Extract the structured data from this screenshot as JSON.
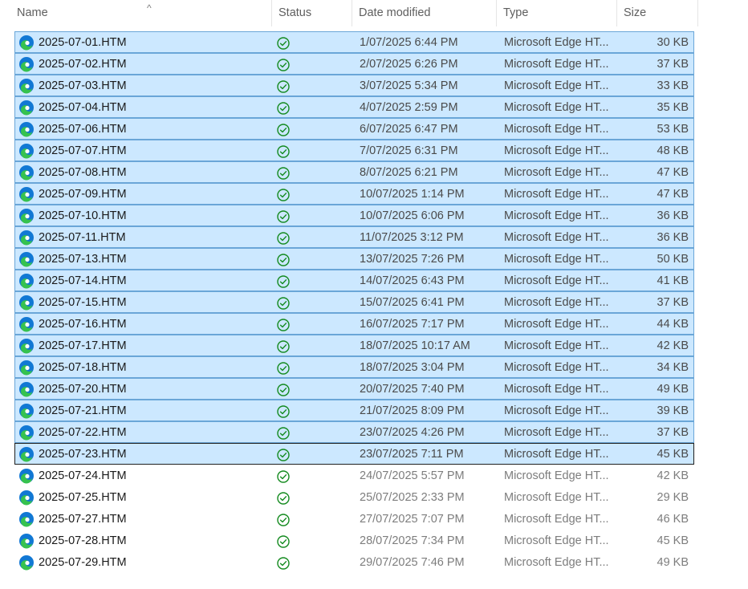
{
  "columns": {
    "name": "Name",
    "status": "Status",
    "date": "Date modified",
    "type": "Type",
    "size": "Size"
  },
  "sort_indicator": "^",
  "icons": {
    "file": "edge-file-icon",
    "status": "synced-check-icon"
  },
  "colors": {
    "selection_bg": "#cce8ff",
    "selection_border": "#6aa6d8",
    "status_green": "#138a1e",
    "edge_blue": "#1178d4",
    "edge_green": "#36c24f"
  },
  "files": [
    {
      "name": "2025-07-01.HTM",
      "date": "1/07/2025 6:44 PM",
      "type": "Microsoft Edge HT...",
      "size": "30 KB",
      "selected": true
    },
    {
      "name": "2025-07-02.HTM",
      "date": "2/07/2025 6:26 PM",
      "type": "Microsoft Edge HT...",
      "size": "37 KB",
      "selected": true
    },
    {
      "name": "2025-07-03.HTM",
      "date": "3/07/2025 5:34 PM",
      "type": "Microsoft Edge HT...",
      "size": "33 KB",
      "selected": true
    },
    {
      "name": "2025-07-04.HTM",
      "date": "4/07/2025 2:59 PM",
      "type": "Microsoft Edge HT...",
      "size": "35 KB",
      "selected": true
    },
    {
      "name": "2025-07-06.HTM",
      "date": "6/07/2025 6:47 PM",
      "type": "Microsoft Edge HT...",
      "size": "53 KB",
      "selected": true
    },
    {
      "name": "2025-07-07.HTM",
      "date": "7/07/2025 6:31 PM",
      "type": "Microsoft Edge HT...",
      "size": "48 KB",
      "selected": true
    },
    {
      "name": "2025-07-08.HTM",
      "date": "8/07/2025 6:21 PM",
      "type": "Microsoft Edge HT...",
      "size": "47 KB",
      "selected": true
    },
    {
      "name": "2025-07-09.HTM",
      "date": "10/07/2025 1:14 PM",
      "type": "Microsoft Edge HT...",
      "size": "47 KB",
      "selected": true
    },
    {
      "name": "2025-07-10.HTM",
      "date": "10/07/2025 6:06 PM",
      "type": "Microsoft Edge HT...",
      "size": "36 KB",
      "selected": true
    },
    {
      "name": "2025-07-11.HTM",
      "date": "11/07/2025 3:12 PM",
      "type": "Microsoft Edge HT...",
      "size": "36 KB",
      "selected": true
    },
    {
      "name": "2025-07-13.HTM",
      "date": "13/07/2025 7:26 PM",
      "type": "Microsoft Edge HT...",
      "size": "50 KB",
      "selected": true
    },
    {
      "name": "2025-07-14.HTM",
      "date": "14/07/2025 6:43 PM",
      "type": "Microsoft Edge HT...",
      "size": "41 KB",
      "selected": true
    },
    {
      "name": "2025-07-15.HTM",
      "date": "15/07/2025 6:41 PM",
      "type": "Microsoft Edge HT...",
      "size": "37 KB",
      "selected": true
    },
    {
      "name": "2025-07-16.HTM",
      "date": "16/07/2025 7:17 PM",
      "type": "Microsoft Edge HT...",
      "size": "44 KB",
      "selected": true
    },
    {
      "name": "2025-07-17.HTM",
      "date": "18/07/2025 10:17 AM",
      "type": "Microsoft Edge HT...",
      "size": "42 KB",
      "selected": true
    },
    {
      "name": "2025-07-18.HTM",
      "date": "18/07/2025 3:04 PM",
      "type": "Microsoft Edge HT...",
      "size": "34 KB",
      "selected": true
    },
    {
      "name": "2025-07-20.HTM",
      "date": "20/07/2025 7:40 PM",
      "type": "Microsoft Edge HT...",
      "size": "49 KB",
      "selected": true
    },
    {
      "name": "2025-07-21.HTM",
      "date": "21/07/2025 8:09 PM",
      "type": "Microsoft Edge HT...",
      "size": "39 KB",
      "selected": true
    },
    {
      "name": "2025-07-22.HTM",
      "date": "23/07/2025 4:26 PM",
      "type": "Microsoft Edge HT...",
      "size": "37 KB",
      "selected": true
    },
    {
      "name": "2025-07-23.HTM",
      "date": "23/07/2025 7:11 PM",
      "type": "Microsoft Edge HT...",
      "size": "45 KB",
      "selected": true,
      "focused": true
    },
    {
      "name": "2025-07-24.HTM",
      "date": "24/07/2025 5:57 PM",
      "type": "Microsoft Edge HT...",
      "size": "42 KB",
      "selected": false
    },
    {
      "name": "2025-07-25.HTM",
      "date": "25/07/2025 2:33 PM",
      "type": "Microsoft Edge HT...",
      "size": "29 KB",
      "selected": false
    },
    {
      "name": "2025-07-27.HTM",
      "date": "27/07/2025 7:07 PM",
      "type": "Microsoft Edge HT...",
      "size": "46 KB",
      "selected": false
    },
    {
      "name": "2025-07-28.HTM",
      "date": "28/07/2025 7:34 PM",
      "type": "Microsoft Edge HT...",
      "size": "45 KB",
      "selected": false
    },
    {
      "name": "2025-07-29.HTM",
      "date": "29/07/2025 7:46 PM",
      "type": "Microsoft Edge HT...",
      "size": "49 KB",
      "selected": false
    }
  ]
}
